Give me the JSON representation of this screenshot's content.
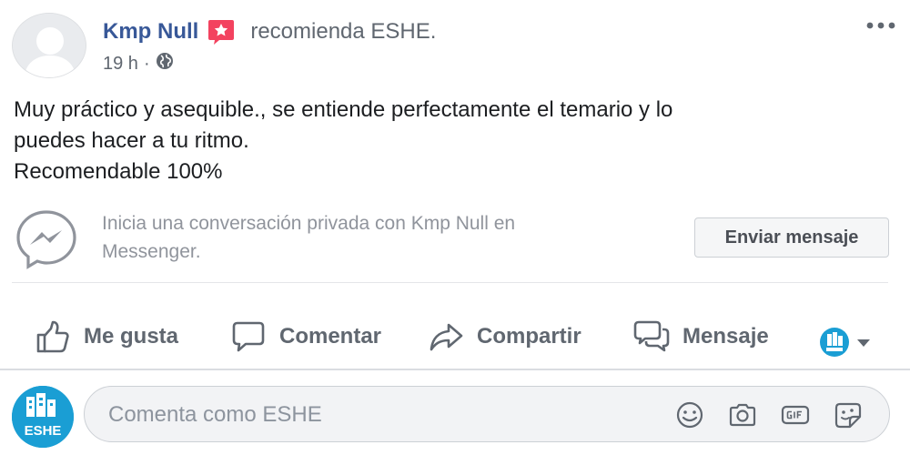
{
  "post": {
    "author_name": "Kmp Null",
    "recommendation_text": "recomienda ESHE.",
    "time": "19 h",
    "separator": "·",
    "privacy_icon": "globe-icon",
    "body_lines": [
      "Muy práctico y asequible., se entiende perfectamente el temario y lo",
      "puedes hacer a tu ritmo.",
      "Recomendable 100%"
    ]
  },
  "messenger": {
    "prompt_line1": "Inicia una conversación privada con Kmp Null en",
    "prompt_line2": "Messenger.",
    "button_label": "Enviar mensaje"
  },
  "actions": {
    "like": "Me gusta",
    "comment": "Comentar",
    "share": "Compartir",
    "message": "Mensaje"
  },
  "composer": {
    "placeholder": "Comenta como ESHE",
    "page_avatar_text": "ESHE",
    "icons": [
      "emoji-icon",
      "camera-icon",
      "gif-icon",
      "sticker-icon"
    ]
  },
  "colors": {
    "link_blue": "#385898",
    "secondary_text": "#606770",
    "recommend_badge": "#f3425f",
    "brand_blue": "#1a9ed4"
  }
}
